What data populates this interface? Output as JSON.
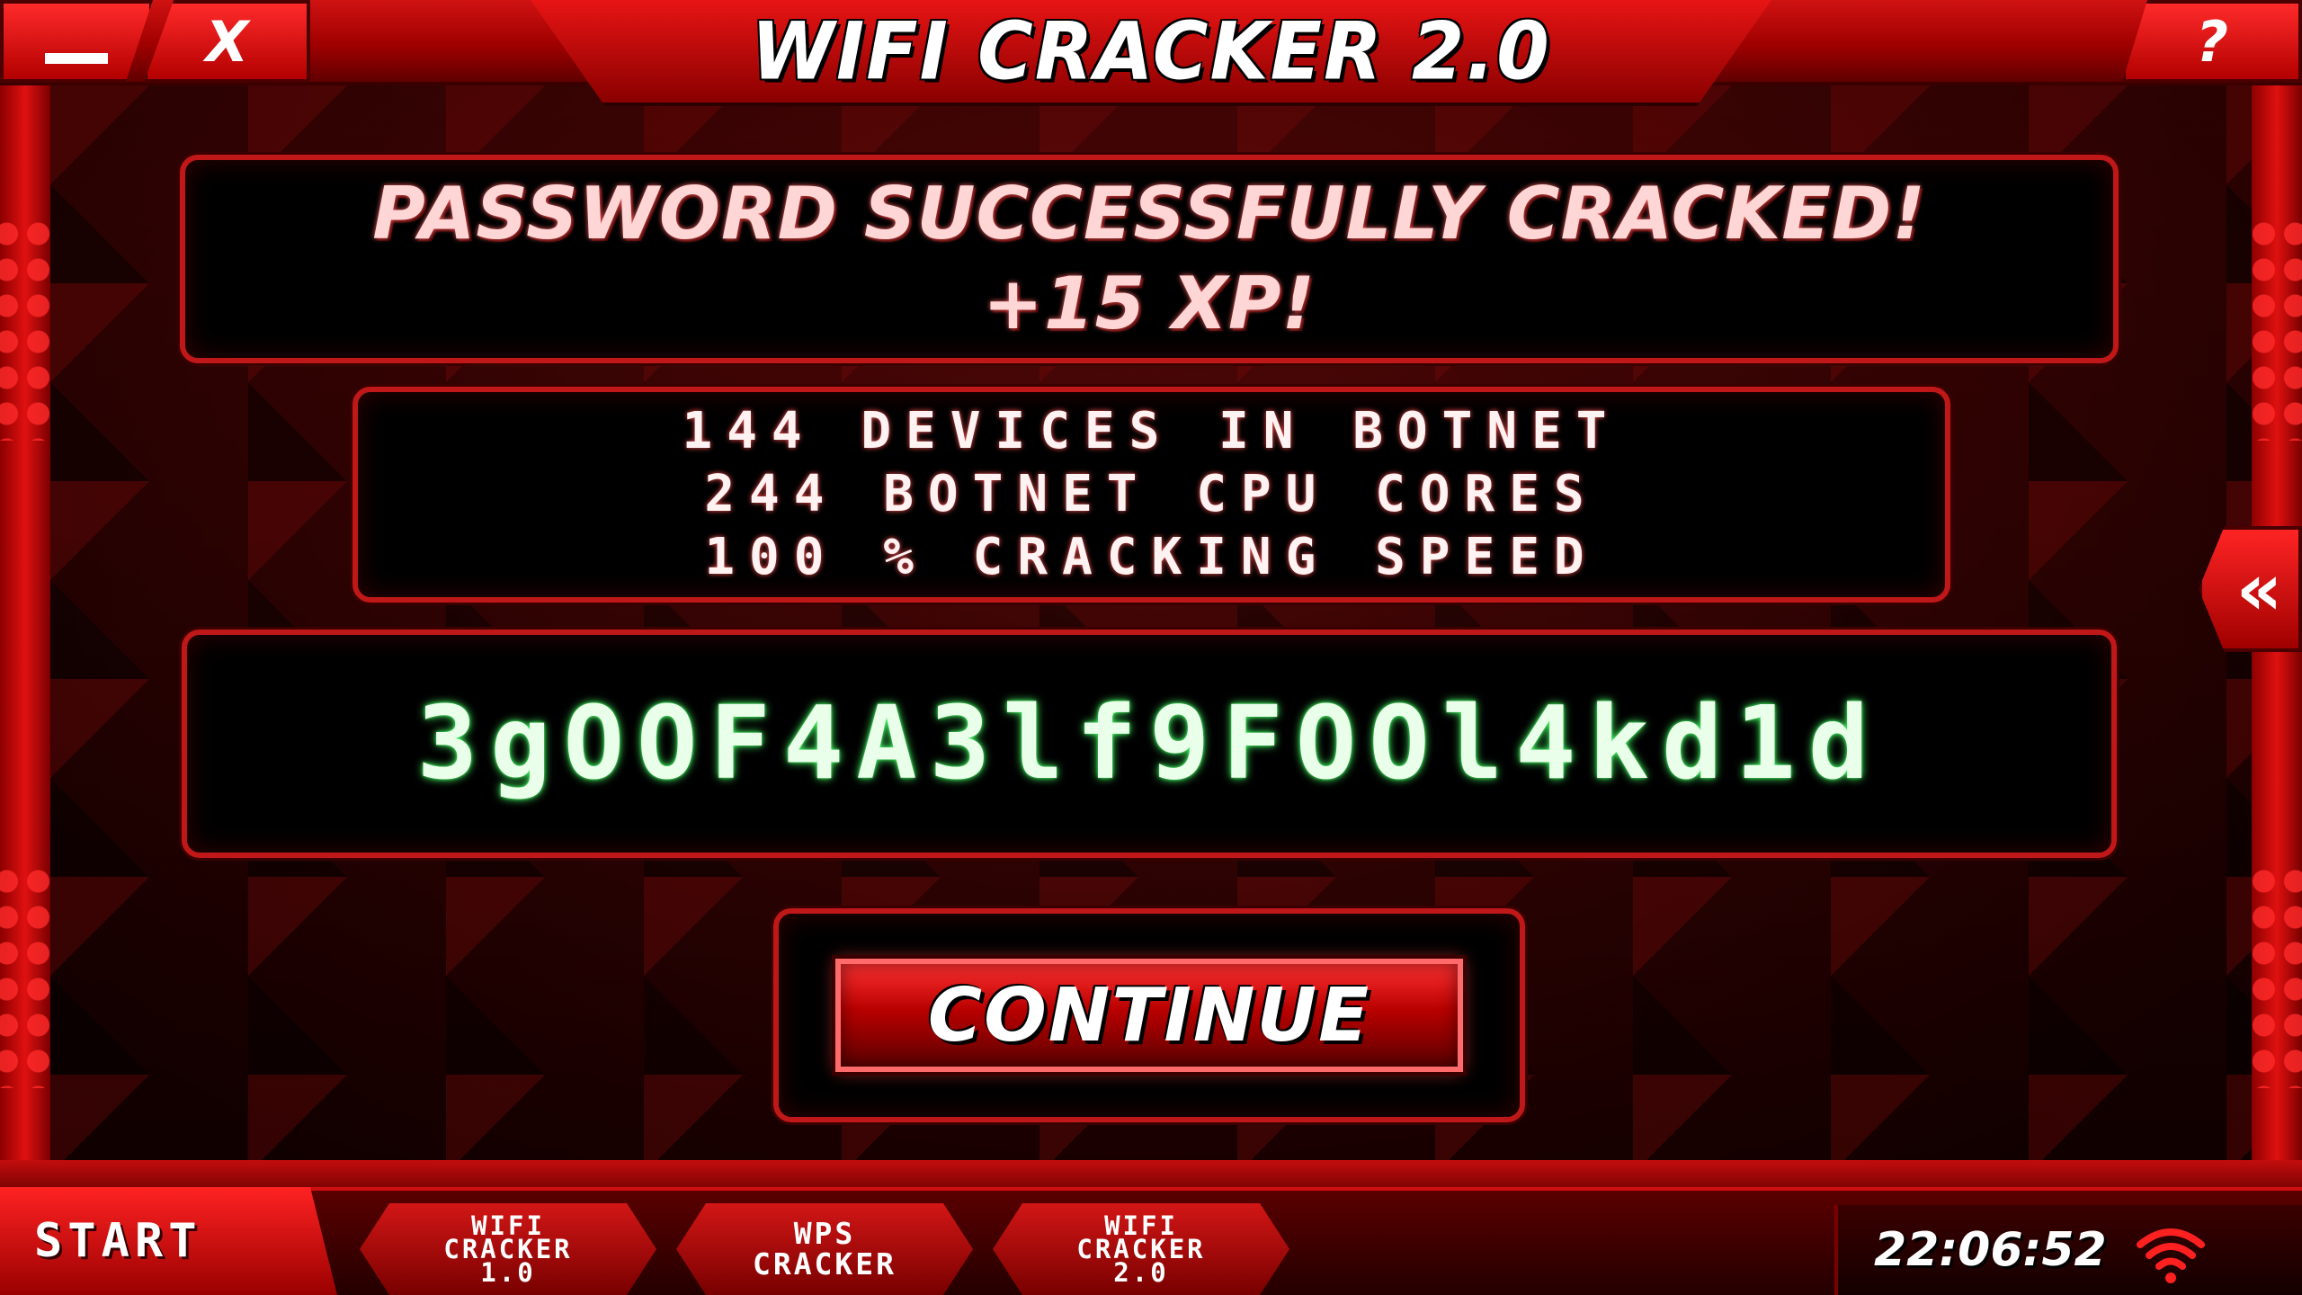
{
  "window": {
    "title": "WIFI CRACKER 2.0",
    "minimize_icon": "minimize-icon",
    "close_label": "X",
    "help_label": "?"
  },
  "success": {
    "line1": "PASSWORD SUCCESSFULLY CRACKED!",
    "line2": "+15 XP!"
  },
  "stats": {
    "devices": "144 DEVICES IN BOTNET",
    "cores": "244 BOTNET CPU CORES",
    "speed": "100 % CRACKING SPEED"
  },
  "password": {
    "value": "3gOOF4A3lf9FOOl4kd1d"
  },
  "continue_button": {
    "label": "CONTINUE"
  },
  "side_tab": {
    "icon": "double-chevron-left-icon",
    "glyph": "«"
  },
  "taskbar": {
    "start_label": "START",
    "apps": [
      {
        "line1": "WIFI",
        "line2": "CRACKER",
        "line3": "1.0"
      },
      {
        "line1": "WPS",
        "line2": "CRACKER"
      },
      {
        "line1": "WIFI",
        "line2": "CRACKER",
        "line3": "2.0"
      }
    ],
    "clock": "22:06:52",
    "wifi_icon": "wifi-icon"
  },
  "colors": {
    "accent": "#d01212",
    "panel_border": "#c01818",
    "password_glow": "#48ff6a"
  }
}
